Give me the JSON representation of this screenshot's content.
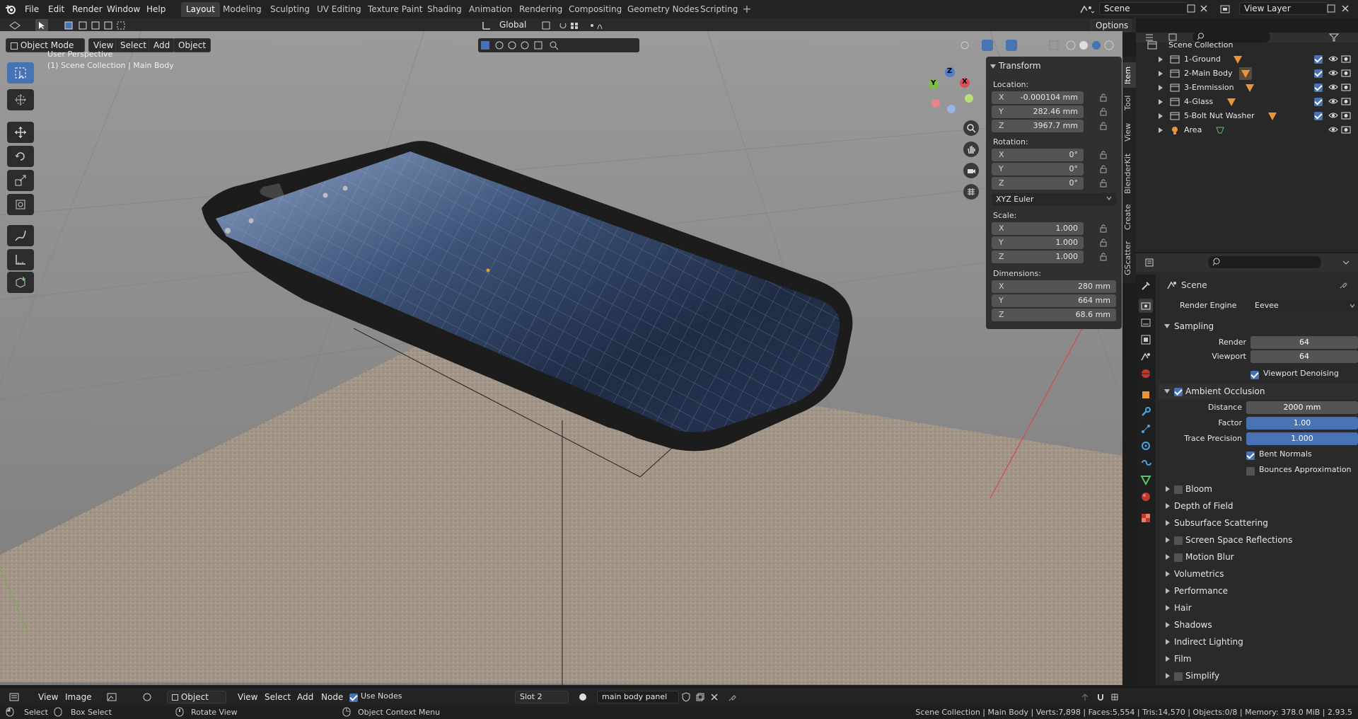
{
  "app": {
    "logo_icon": "blender-logo-icon"
  },
  "topbar": {
    "menus": [
      "File",
      "Edit",
      "Render",
      "Window",
      "Help"
    ],
    "workspaces": [
      "Layout",
      "Modeling",
      "Sculpting",
      "UV Editing",
      "Texture Paint",
      "Shading",
      "Animation",
      "Rendering",
      "Compositing",
      "Geometry Nodes",
      "Scripting"
    ],
    "active_workspace": "Layout",
    "scene_label": "Scene",
    "view_layer_label": "View Layer"
  },
  "viewport": {
    "mode": "Object Mode",
    "menus": [
      "View",
      "Select",
      "Add",
      "Object"
    ],
    "transform_orientation": "Global",
    "options_label": "Options",
    "info_line1": "User Perspective",
    "info_line2": "(1) Scene Collection | Main Body",
    "gizmo": {
      "x": "X",
      "y": "Y",
      "z": "Z"
    }
  },
  "npanel": {
    "title": "Transform",
    "location_label": "Location:",
    "location": {
      "x": "-0.000104 mm",
      "y": "282.46 mm",
      "z": "3967.7 mm"
    },
    "rotation_label": "Rotation:",
    "rotation": {
      "x": "0°",
      "y": "0°",
      "z": "0°"
    },
    "rotation_mode": "XYZ Euler",
    "scale_label": "Scale:",
    "scale": {
      "x": "1.000",
      "y": "1.000",
      "z": "1.000"
    },
    "dimensions_label": "Dimensions:",
    "dimensions": {
      "x": "280 mm",
      "y": "664 mm",
      "z": "68.6 mm"
    },
    "axis": {
      "x": "X",
      "y": "Y",
      "z": "Z"
    },
    "tabs": [
      "Item",
      "Tool",
      "View",
      "BlenderKit",
      "Create",
      "GScatter"
    ]
  },
  "outliner": {
    "root": "Scene Collection",
    "items": [
      {
        "label": "1-Ground"
      },
      {
        "label": "2-Main Body"
      },
      {
        "label": "3-Emmission"
      },
      {
        "label": "4-Glass"
      },
      {
        "label": "5-Bolt Nut Washer"
      },
      {
        "label": "Area"
      }
    ]
  },
  "properties": {
    "context": "Scene",
    "render_engine_label": "Render Engine",
    "render_engine": "Eevee",
    "sampling": {
      "title": "Sampling",
      "render_label": "Render",
      "render_value": "64",
      "viewport_label": "Viewport",
      "viewport_value": "64",
      "denoise_label": "Viewport Denoising"
    },
    "ao": {
      "title": "Ambient Occlusion",
      "distance_label": "Distance",
      "distance": "2000 mm",
      "factor_label": "Factor",
      "factor": "1.00",
      "trace_label": "Trace Precision",
      "trace": "1.000",
      "bent_label": "Bent Normals",
      "bounces_label": "Bounces Approximation"
    },
    "panels": [
      "Bloom",
      "Depth of Field",
      "Subsurface Scattering",
      "Screen Space Reflections",
      "Motion Blur",
      "Volumetrics",
      "Performance",
      "Hair",
      "Shadows",
      "Indirect Lighting",
      "Film",
      "Simplify"
    ]
  },
  "editor_header": {
    "menus": [
      "View",
      "Image"
    ],
    "object_label": "Object",
    "menus2": [
      "View",
      "Select",
      "Add",
      "Node"
    ],
    "use_nodes_label": "Use Nodes",
    "slot": "Slot 2",
    "material": "main body panel"
  },
  "status": {
    "select": "Select",
    "box_select": "Box Select",
    "rotate_view": "Rotate View",
    "context_menu": "Object Context Menu",
    "stats": "Scene Collection | Main Body | Verts:7,898 | Faces:5,554 | Tris:14,570 | Objects:0/8 | Memory: 378.0 MiB | 2.93.5"
  }
}
